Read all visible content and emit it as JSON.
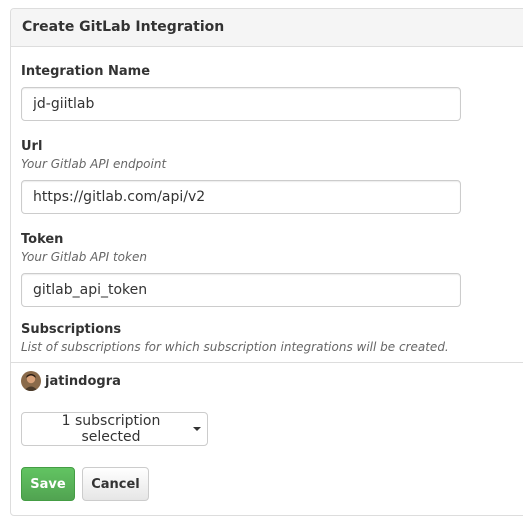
{
  "panel": {
    "title": "Create GitLab Integration"
  },
  "form": {
    "name_label": "Integration Name",
    "name_value": "jd-giitlab",
    "url_label": "Url",
    "url_hint": "Your Gitlab API endpoint",
    "url_value": "https://gitlab.com/api/v2",
    "token_label": "Token",
    "token_hint": "Your Gitlab API token",
    "token_value": "gitlab_api_token",
    "subscriptions_label": "Subscriptions",
    "subscriptions_hint": "List of subscriptions for which subscription integrations will be created."
  },
  "subscriptions": {
    "items": [
      {
        "name": "jatindogra",
        "icon": "user-avatar-icon"
      }
    ],
    "dropdown_label": "1 subscription selected"
  },
  "actions": {
    "save_label": "Save",
    "cancel_label": "Cancel"
  },
  "colors": {
    "save_button": "#5cb85c",
    "heading_background": "#f5f5f5",
    "border": "#dddddd"
  }
}
